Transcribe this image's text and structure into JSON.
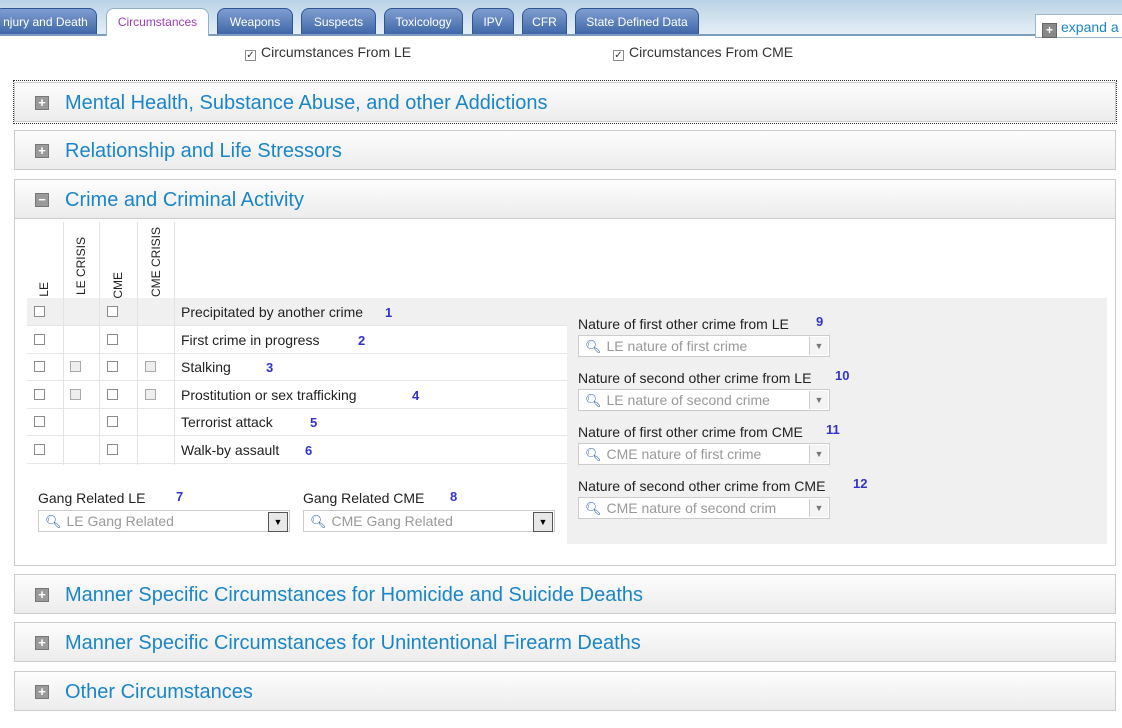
{
  "tabs": [
    {
      "label": "njury and Death"
    },
    {
      "label": "Circumstances",
      "active": true
    },
    {
      "label": "Weapons"
    },
    {
      "label": "Suspects"
    },
    {
      "label": "Toxicology"
    },
    {
      "label": "IPV"
    },
    {
      "label": "CFR"
    },
    {
      "label": "State Defined Data"
    }
  ],
  "expand_label": "expand a",
  "filters": {
    "le": "Circumstances From LE",
    "cme": "Circumstances From CME",
    "le_checked": true,
    "cme_checked": true
  },
  "sections": {
    "mental": "Mental Health, Substance Abuse, and other Addictions",
    "relationship": "Relationship and Life Stressors",
    "crime": "Crime and Criminal Activity",
    "manner": "Manner Specific Circumstances for Homicide and Suicide Deaths",
    "firearm": "Manner Specific Circumstances for Unintentional Firearm Deaths",
    "other": "Other Circumstances"
  },
  "columns": [
    "LE",
    "LE CRISIS",
    "CME",
    "CME CRISIS"
  ],
  "rows": [
    {
      "label": "Precipitated by another crime",
      "num": "1"
    },
    {
      "label": "First crime in progress",
      "num": "2"
    },
    {
      "label": "Stalking",
      "num": "3"
    },
    {
      "label": "Prostitution or sex trafficking",
      "num": "4"
    },
    {
      "label": "Terrorist attack",
      "num": "5"
    },
    {
      "label": "Walk-by assault",
      "num": "6"
    }
  ],
  "gang": {
    "le_label": "Gang Related LE",
    "le_num": "7",
    "le_placeholder": "LE Gang Related",
    "cme_label": "Gang Related CME",
    "cme_num": "8",
    "cme_placeholder": "CME Gang Related"
  },
  "nature": [
    {
      "label": "Nature of first other crime from LE",
      "num": "9",
      "placeholder": "LE nature of first crime"
    },
    {
      "label": "Nature of second other crime from LE",
      "num": "10",
      "placeholder": "LE nature of second crime"
    },
    {
      "label": "Nature of first other crime from CME",
      "num": "11",
      "placeholder": "CME nature of first crime"
    },
    {
      "label": "Nature of second other crime from CME",
      "num": "12",
      "placeholder": "CME nature of second crim"
    }
  ]
}
